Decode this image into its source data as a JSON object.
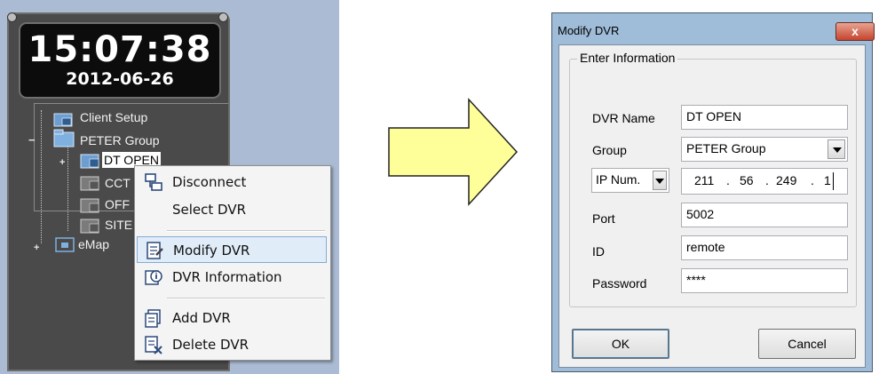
{
  "clock": {
    "time": "15:07:38",
    "date": "2012-06-26"
  },
  "tree": {
    "items": [
      {
        "label": "Client Setup"
      },
      {
        "label": "PETER Group"
      },
      {
        "label": "DT OPEN"
      },
      {
        "label": "CCT"
      },
      {
        "label": "OFF"
      },
      {
        "label": "SITE"
      },
      {
        "label": "eMap"
      }
    ]
  },
  "context_menu": {
    "items": [
      {
        "label": "Disconnect",
        "icon": "disconnect-icon"
      },
      {
        "label": "Select DVR",
        "icon": ""
      },
      {
        "label": "Modify DVR",
        "icon": "modify-dvr-icon"
      },
      {
        "label": "DVR Information",
        "icon": "dvr-information-icon"
      },
      {
        "label": "Add DVR",
        "icon": "add-dvr-icon"
      },
      {
        "label": "Delete DVR",
        "icon": "delete-dvr-icon"
      }
    ]
  },
  "dialog": {
    "title": "Modify DVR",
    "close_label": "x",
    "group_title": "Enter Information",
    "fields": {
      "dvr_name": {
        "label": "DVR Name",
        "value": "DT OPEN"
      },
      "group": {
        "label": "Group",
        "value": "PETER Group"
      },
      "ip_type": {
        "value": "IP Num."
      },
      "ip": {
        "seg1": "211",
        "seg2": "56",
        "seg3": "249",
        "seg4": "1",
        "dot": "."
      },
      "port": {
        "label": "Port",
        "value": "5002"
      },
      "id": {
        "label": "ID",
        "value": "remote"
      },
      "password": {
        "label": "Password",
        "value": "****"
      }
    },
    "ok_label": "OK",
    "cancel_label": "Cancel"
  },
  "colors": {
    "arrow_fill": "#ffff99",
    "highlight": "#e0edf9",
    "panel": "#4a4a4a"
  }
}
